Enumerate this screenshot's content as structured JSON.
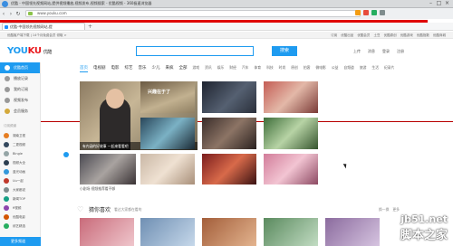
{
  "browser": {
    "title": "优酷 - 中国领先视频网站,提供视频播放,视频发布,视频搜索 - 优酷视频 - 360极速浏览器",
    "url": "www.youku.com",
    "tab_label": "优酷-中国领先视频网站,提",
    "new_tab_symbol": "+",
    "controls": {
      "minimize": "–",
      "maximize": "□",
      "close": "×"
    }
  },
  "site_strip": {
    "left": "优酷客户端下载 | 14个月免费会员 领取 >",
    "right": [
      "订阅",
      "优酷出品",
      "优酷会员",
      "土豆",
      "优酷原创",
      "优酷游戏",
      "优酷指数",
      "优酷商城"
    ]
  },
  "header": {
    "logo_you": "YOU",
    "logo_ku": "KU",
    "logo_cn": "优酷",
    "search_button": "搜索",
    "actions": [
      "上传",
      "消息",
      "登录",
      "注册"
    ]
  },
  "categories": {
    "main": [
      "首页",
      "电视剧",
      "电影",
      "综艺",
      "音乐",
      "少儿",
      "来疯",
      "全部"
    ],
    "more": [
      "游戏",
      "资讯",
      "娱乐",
      "财经",
      "汽车",
      "体育",
      "科技",
      "时尚",
      "原创",
      "拍客",
      "微电影",
      "公益",
      "自频道",
      "旅游",
      "生活",
      "纪录片",
      "亲子",
      "游戏",
      "搞笑",
      "直播",
      "极客",
      "视频下载"
    ]
  },
  "sidebar": {
    "items": [
      {
        "label": "优酷首页",
        "active": true
      },
      {
        "label": "播放记录",
        "active": false
      },
      {
        "label": "我的订阅",
        "active": false
      },
      {
        "label": "视频发布",
        "active": false
      },
      {
        "label": "会员服务",
        "active": false
      }
    ],
    "section_label": "订阅频道",
    "subs": [
      "湖南卫视",
      "二更视频",
      "Bingle",
      "视频大全",
      "蓝光动画",
      "Uu一起",
      "大家都说",
      "新闻TOP",
      "ff视频",
      "优酷电影",
      "综艺精选"
    ],
    "bottom_label": "更多频道"
  },
  "content": {
    "feature_caption": "有内涵的好故事  一起来看看吧",
    "overlay_text": "兴趣在于了",
    "row3_caption": "小剧场 视频推荐看不够",
    "section_title": "猜你喜欢",
    "section_sub": "看过大家都在看的",
    "section_tools": [
      "换一换",
      "更多"
    ]
  },
  "watermark": {
    "en": "jb51.net",
    "zh": "脚本之家"
  }
}
